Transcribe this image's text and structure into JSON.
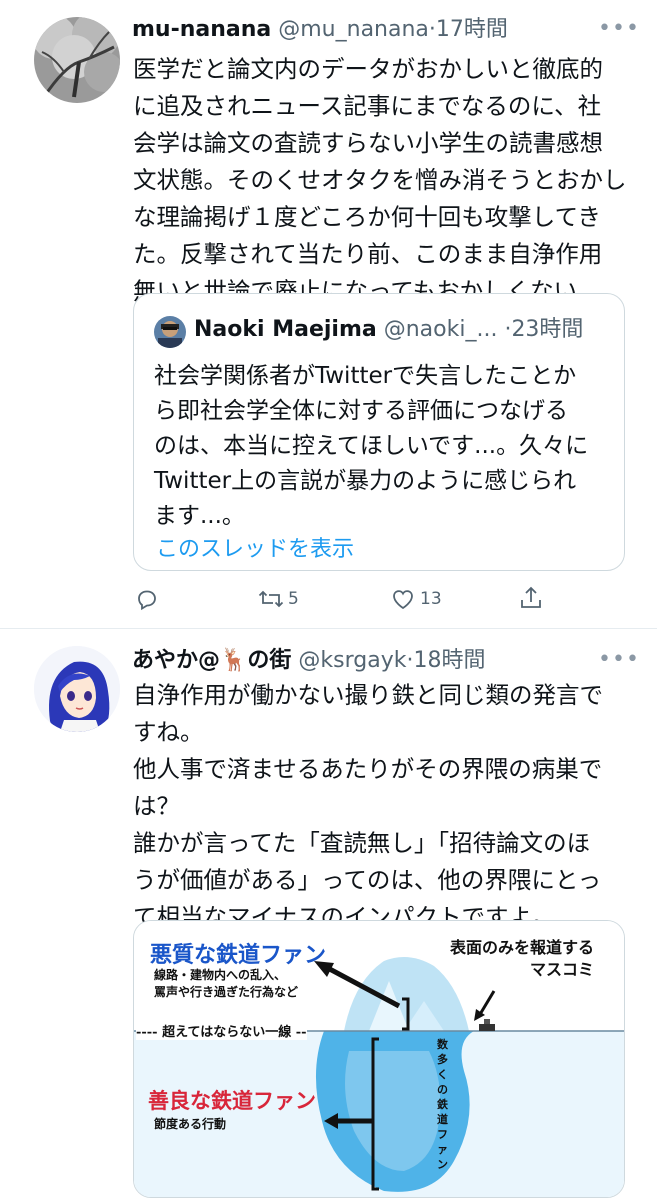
{
  "tweets": [
    {
      "display_name": "mu-nanana",
      "handle": "@mu_nanana",
      "separator": "·",
      "time": "17時間",
      "more": "•••",
      "text": "医学だと論文内のデータがおかしいと徹底的\nに追及されニュース記事にまでなるのに、社\n会学は論文の査読すらない小学生の読書感想\n文状態。そのくせオタクを憎み消そうとおかし\nな理論掲げ１度どころか何十回も攻撃してき\nた。反撃されて当たり前、このまま自浄作用\n無いと世論で廃止になってもおかしくない",
      "quote": {
        "display_name": "Naoki Maejima",
        "handle": "@naoki_...",
        "separator": "·",
        "time": "23時間",
        "text": "社会学関係者がTwitterで失言したことか\nら即社会学全体に対する評価につなげる\nのは、本当に控えてほしいです...。久々に\nTwitter上の言説が暴力のように感じられ\nます...。",
        "show_thread": "このスレッドを表示"
      },
      "actions": {
        "reply_count": "",
        "retweet_count": "5",
        "like_count": "13"
      }
    },
    {
      "display_name": "あやか@🦌の街",
      "handle": "@ksrgayk",
      "separator": "·",
      "time": "18時間",
      "more": "•••",
      "text": "自浄作用が働かない撮り鉄と同じ類の発言で\nすね。\n他人事で済ませるあたりがその界隈の病巣で\nは？\n誰かが言ってた「査読無し」「招待論文のほ\nうが価値がある」ってのは、他の界隈にとっ\nて相当なマイナスのインパクトですよ。",
      "media": {
        "bad_fan": "悪質な鉄道ファン",
        "bad_fan_desc": "線路・建物内への乱入、\n罵声や行き過ぎた行為など",
        "media_only": "表面のみを報道する\nマスコミ",
        "line_label": "---- 超えてはならない一線 --",
        "many_fans": "数\n多\nく\nの\n鉄\n道\nフ\nァ\nン",
        "good_fan": "善良な鉄道ファン",
        "good_fan_desc": "節度ある行動",
        "colors": {
          "bad": "#1a56c9",
          "good": "#d8263a",
          "ice": "#9fd3ef",
          "water": "#4fb3e8"
        }
      }
    }
  ]
}
